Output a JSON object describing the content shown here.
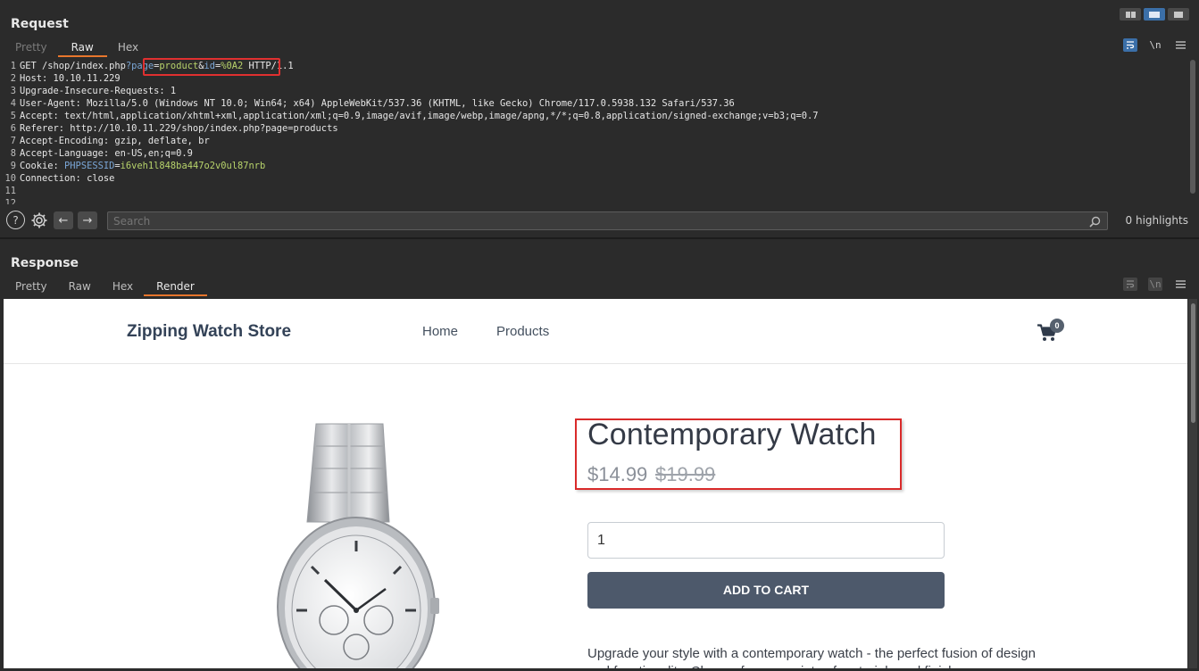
{
  "request": {
    "title": "Request",
    "tabs": [
      "Pretty",
      "Raw",
      "Hex"
    ],
    "active_tab": "Raw",
    "wrap_label": "\\n",
    "lines": [
      {
        "n": "1",
        "segments": [
          {
            "t": "GET /shop/index.php",
            "c": "key"
          },
          {
            "t": "?",
            "c": "param"
          },
          {
            "t": "page",
            "c": "param"
          },
          {
            "t": "=",
            "c": "key"
          },
          {
            "t": "product",
            "c": "val"
          },
          {
            "t": "&",
            "c": "key"
          },
          {
            "t": "id",
            "c": "param"
          },
          {
            "t": "=",
            "c": "key"
          },
          {
            "t": "%0A2",
            "c": "val"
          },
          {
            "t": " HTTP/1.1",
            "c": "key"
          }
        ]
      },
      {
        "n": "2",
        "segments": [
          {
            "t": "Host: 10.10.11.229",
            "c": "key"
          }
        ]
      },
      {
        "n": "3",
        "segments": [
          {
            "t": "Upgrade-Insecure-Requests: 1",
            "c": "key"
          }
        ]
      },
      {
        "n": "4",
        "segments": [
          {
            "t": "User-Agent: Mozilla/5.0 (Windows NT 10.0; Win64; x64) AppleWebKit/537.36 (KHTML, like Gecko) Chrome/117.0.5938.132 Safari/537.36",
            "c": "key"
          }
        ]
      },
      {
        "n": "5",
        "segments": [
          {
            "t": "Accept: text/html,application/xhtml+xml,application/xml;q=0.9,image/avif,image/webp,image/apng,*/*;q=0.8,application/signed-exchange;v=b3;q=0.7",
            "c": "key"
          }
        ]
      },
      {
        "n": "6",
        "segments": [
          {
            "t": "Referer: http://10.10.11.229/shop/index.php?page=products",
            "c": "key"
          }
        ]
      },
      {
        "n": "7",
        "segments": [
          {
            "t": "Accept-Encoding: gzip, deflate, br",
            "c": "key"
          }
        ]
      },
      {
        "n": "8",
        "segments": [
          {
            "t": "Accept-Language: en-US,en;q=0.9",
            "c": "key"
          }
        ]
      },
      {
        "n": "9",
        "segments": [
          {
            "t": "Cookie: ",
            "c": "key"
          },
          {
            "t": "PHPSESSID",
            "c": "param"
          },
          {
            "t": "=",
            "c": "key"
          },
          {
            "t": "i6veh1l848ba447o2v0ul87nrb",
            "c": "val"
          }
        ]
      },
      {
        "n": "10",
        "segments": [
          {
            "t": "Connection: close",
            "c": "key"
          }
        ]
      },
      {
        "n": "11",
        "segments": [
          {
            "t": "",
            "c": "key"
          }
        ]
      },
      {
        "n": "12",
        "segments": [
          {
            "t": "",
            "c": "key"
          }
        ]
      }
    ]
  },
  "search": {
    "placeholder": "Search",
    "highlights": "0 highlights"
  },
  "response": {
    "title": "Response",
    "tabs": [
      "Pretty",
      "Raw",
      "Hex",
      "Render"
    ],
    "active_tab": "Render"
  },
  "site": {
    "brand": "Zipping Watch Store",
    "nav": [
      "Home",
      "Products"
    ],
    "cart_count": "0",
    "product_title": "Contemporary Watch",
    "price": "$14.99",
    "old_price": "$19.99",
    "quantity": "1",
    "add_to_cart": "ADD TO CART",
    "description": "Upgrade your style with a contemporary watch - the perfect fusion of design and functionality. Choose from a variety of materials and finishes"
  },
  "colors": {
    "accent_tab": "#e8762d",
    "highlight_box": "#e03030",
    "param": "#7aa6d6",
    "value": "#b7d36b",
    "button": "#4d596b"
  }
}
